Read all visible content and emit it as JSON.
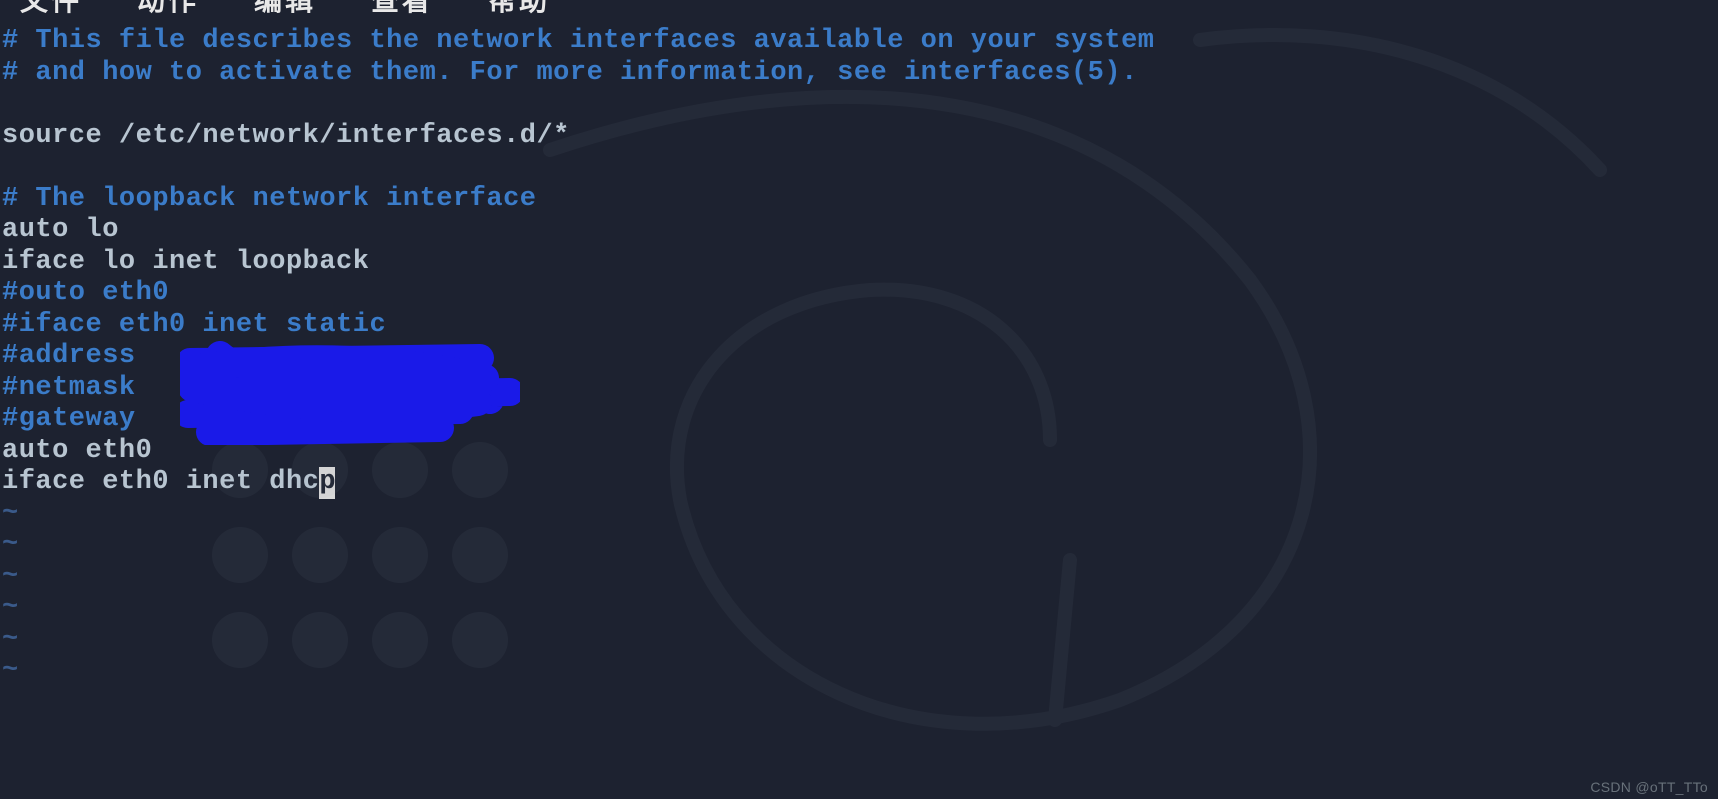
{
  "menu": {
    "items": [
      "文件",
      "动作",
      "编辑",
      "查看",
      "帮助"
    ]
  },
  "editor": {
    "lines": [
      {
        "type": "comment",
        "text": "# This file describes the network interfaces available on your system"
      },
      {
        "type": "comment",
        "text": "# and how to activate them. For more information, see interfaces(5)."
      },
      {
        "type": "blank",
        "text": ""
      },
      {
        "type": "normal",
        "text": "source /etc/network/interfaces.d/*"
      },
      {
        "type": "blank",
        "text": ""
      },
      {
        "type": "comment",
        "text": "# The loopback network interface"
      },
      {
        "type": "normal",
        "text": "auto lo"
      },
      {
        "type": "normal",
        "text": "iface lo inet loopback"
      },
      {
        "type": "comment",
        "text": "#outo eth0"
      },
      {
        "type": "comment",
        "text": "#iface eth0 inet static"
      },
      {
        "type": "comment",
        "text": "#address "
      },
      {
        "type": "comment",
        "text": "#netmask "
      },
      {
        "type": "comment",
        "text": "#gateway "
      },
      {
        "type": "normal",
        "text": "auto eth0"
      },
      {
        "type": "normal-cursor",
        "text": "iface eth0 inet dhc",
        "cursor": "p"
      }
    ],
    "tilde_count": 6,
    "tilde_char": "~"
  },
  "watermark": "CSDN @oTT_TTo"
}
